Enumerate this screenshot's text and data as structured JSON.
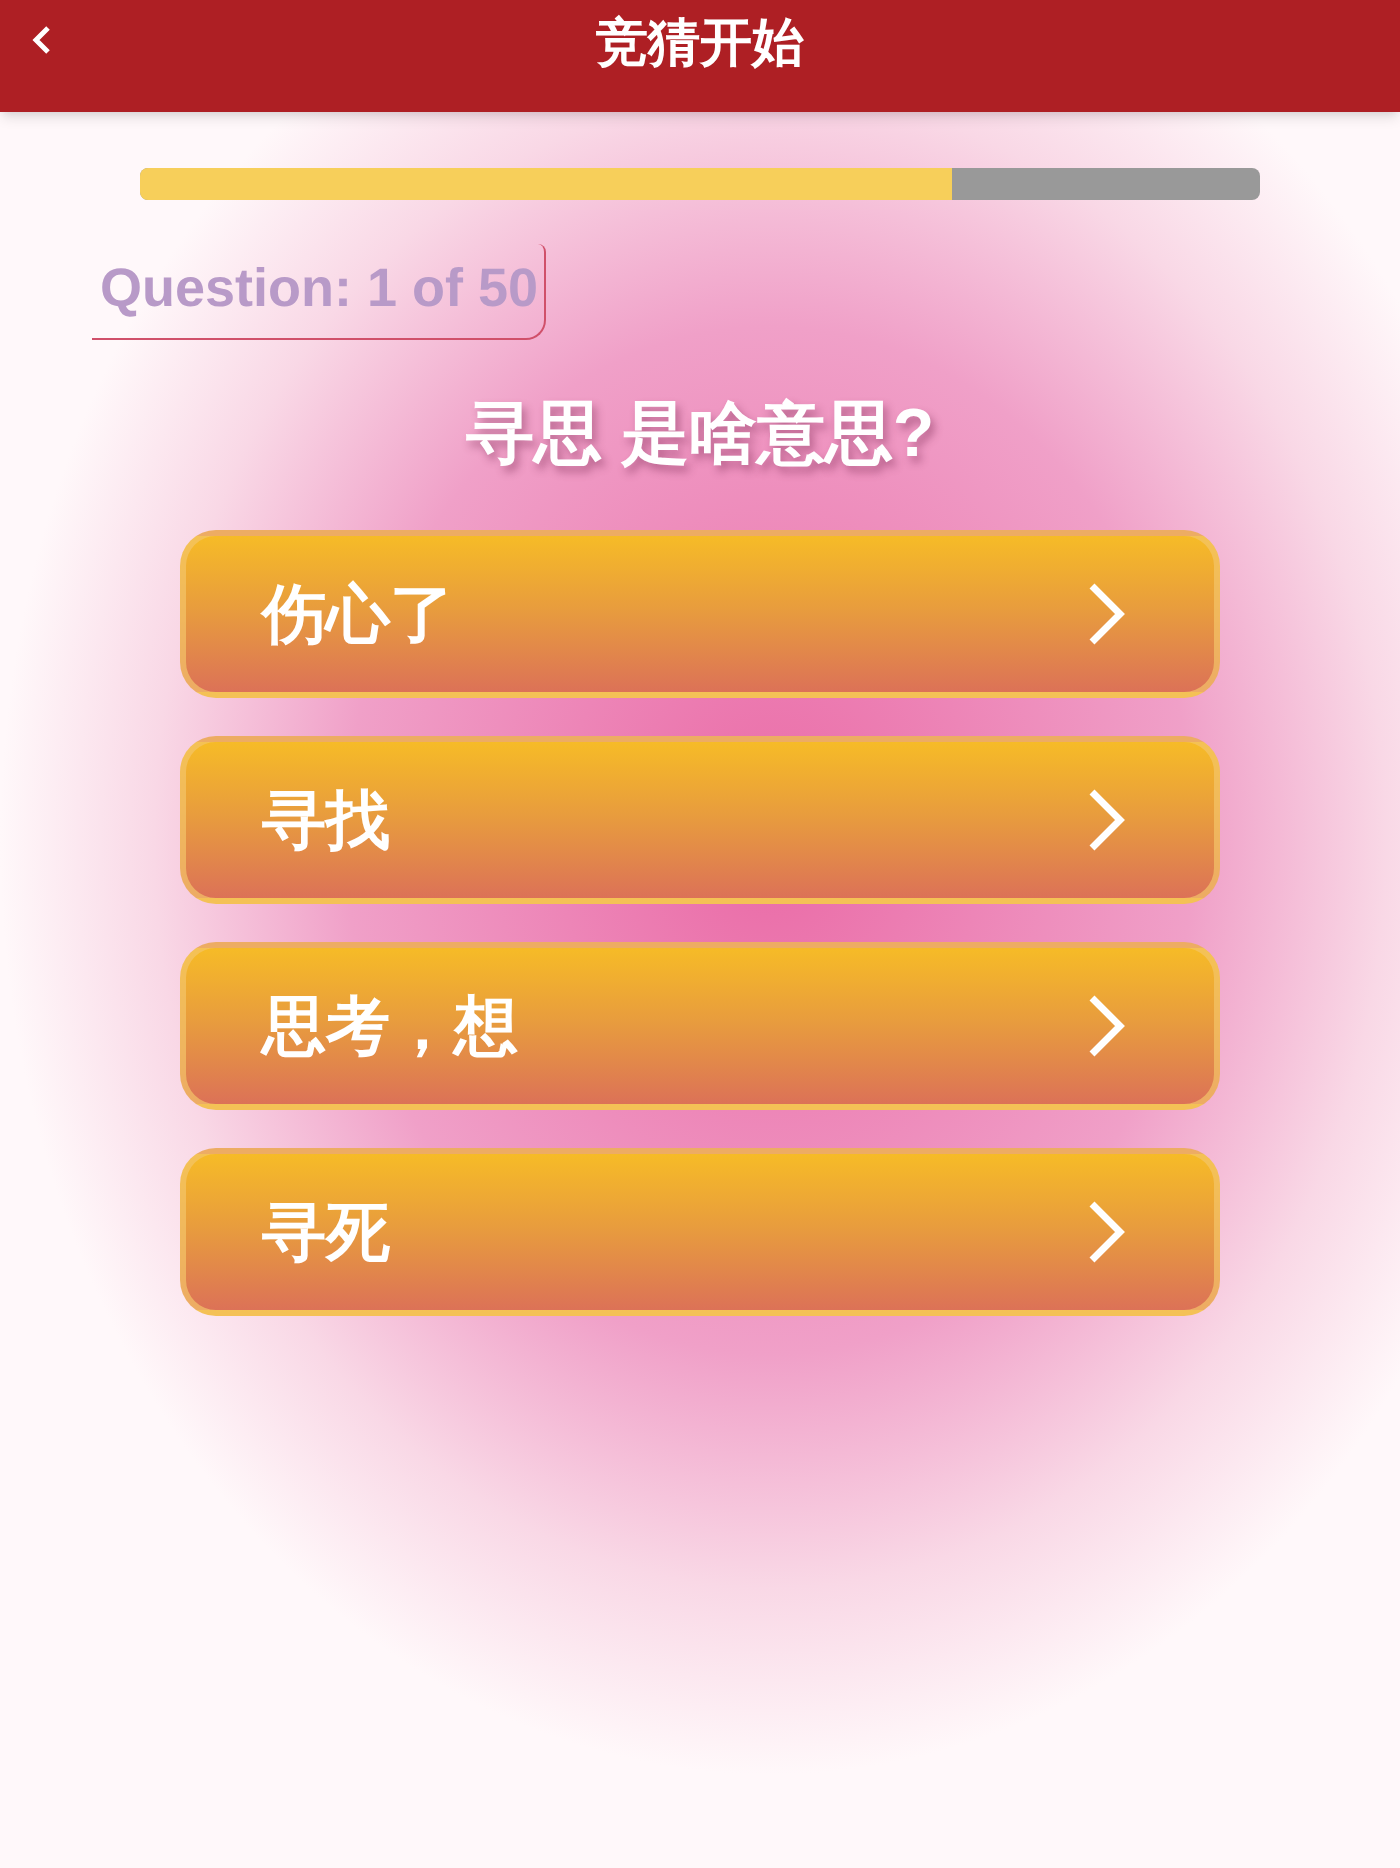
{
  "header": {
    "title": "竞猜开始"
  },
  "progress": {
    "level": 0.725
  },
  "counter": "Question: 1 of 50",
  "question": "寻思 是啥意思?",
  "answers": [
    {
      "label": "伤心了"
    },
    {
      "label": "寻找"
    },
    {
      "label": "思考，想"
    },
    {
      "label": "寻死"
    }
  ]
}
